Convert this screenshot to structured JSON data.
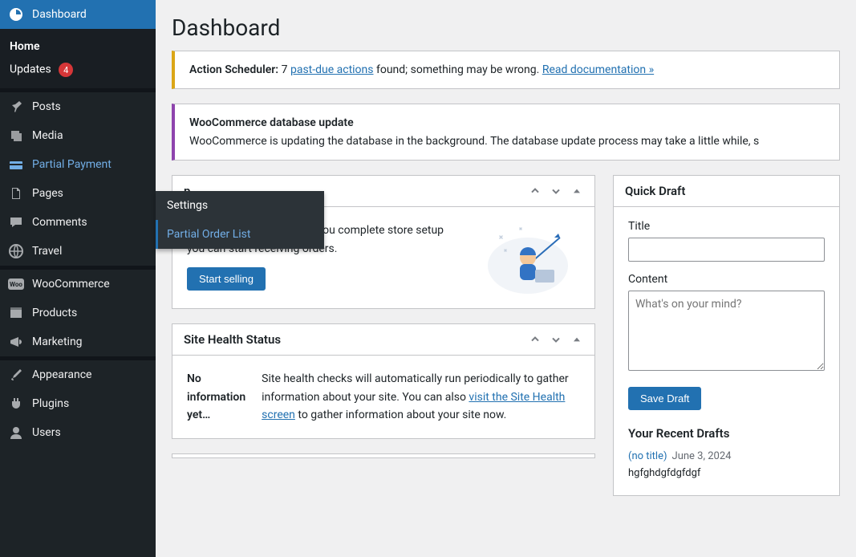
{
  "sidebar": {
    "dashboard": "Dashboard",
    "home": "Home",
    "updates": "Updates",
    "updates_count": "4",
    "posts": "Posts",
    "media": "Media",
    "partial_payment": "Partial Payment",
    "pages": "Pages",
    "comments": "Comments",
    "travel": "Travel",
    "woocommerce": "WooCommerce",
    "products": "Products",
    "marketing": "Marketing",
    "appearance": "Appearance",
    "plugins": "Plugins",
    "users": "Users"
  },
  "flyout": {
    "settings": "Settings",
    "partial_order_list": "Partial Order List"
  },
  "page": {
    "title": "Dashboard"
  },
  "notices": {
    "scheduler_label": "Action Scheduler:",
    "scheduler_count": "7",
    "scheduler_link": "past-due actions",
    "scheduler_tail": "found; something may be wrong.",
    "scheduler_doc": "Read documentation »",
    "woo_title": "WooCommerce database update",
    "woo_body": "WooCommerce is updating the database in the background. The database update process may take a little while, s"
  },
  "setup": {
    "title": "p",
    "body": "You're almost there! Once you complete store setup you can start receiving orders.",
    "button": "Start selling"
  },
  "health": {
    "title": "Site Health Status",
    "label": "No information yet…",
    "body_pre": "Site health checks will automatically run periodically to gather information about your site. You can also ",
    "body_link": "visit the Site Health screen",
    "body_post": " to gather information about your site now."
  },
  "quick": {
    "title": "Quick Draft",
    "title_label": "Title",
    "content_label": "Content",
    "content_placeholder": "What's on your mind?",
    "save": "Save Draft",
    "recent_title": "Your Recent Drafts",
    "draft_link": "(no title)",
    "draft_date": "June 3, 2024",
    "draft_excerpt": "hgfghdgfdgfdgf"
  }
}
